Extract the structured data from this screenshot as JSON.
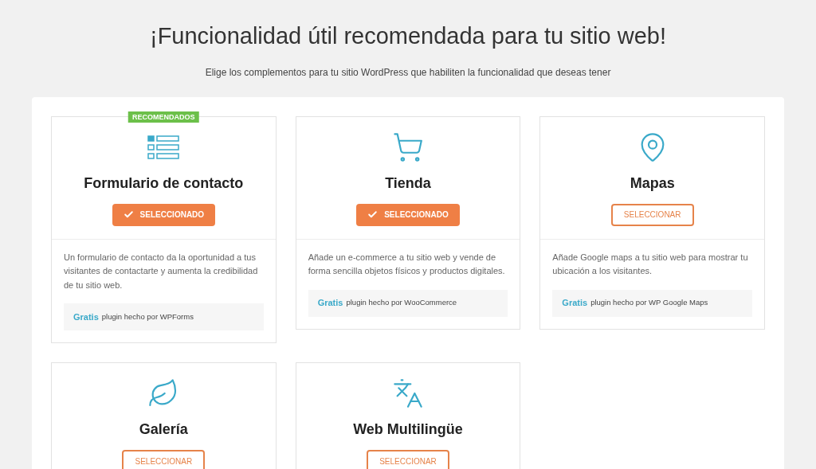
{
  "heading": "¡Funcionalidad útil recomendada para tu sitio web!",
  "subheading": "Elige los complementos para tu sitio WordPress que habiliten la funcionalidad que deseas tener",
  "cards": [
    {
      "kind": "form",
      "badge": "RECOMENDADOS",
      "title": "Formulario de contacto",
      "button": "SELECCIONADO",
      "selected": true,
      "description": "Un formulario de contacto da la oportunidad a tus visitantes de contactarte y aumenta la credibilidad de tu sitio web.",
      "price": "Gratis",
      "credit": "plugin hecho por WPForms"
    },
    {
      "kind": "cart",
      "title": "Tienda",
      "button": "SELECCIONADO",
      "selected": true,
      "description": "Añade un e-commerce a tu sitio web y vende de forma sencilla objetos físicos y productos digitales.",
      "price": "Gratis",
      "credit": "plugin hecho por WooCommerce"
    },
    {
      "kind": "pin",
      "title": "Mapas",
      "button": "SELECCIONAR",
      "selected": false,
      "description": "Añade Google maps a tu sitio web para mostrar tu ubicación a los visitantes.",
      "price": "Gratis",
      "credit": "plugin hecho por WP Google Maps"
    },
    {
      "kind": "leaf",
      "title": "Galería",
      "button": "SELECCIONAR",
      "selected": false
    },
    {
      "kind": "translate",
      "title": "Web Multilingüe",
      "button": "SELECCIONAR",
      "selected": false
    }
  ]
}
